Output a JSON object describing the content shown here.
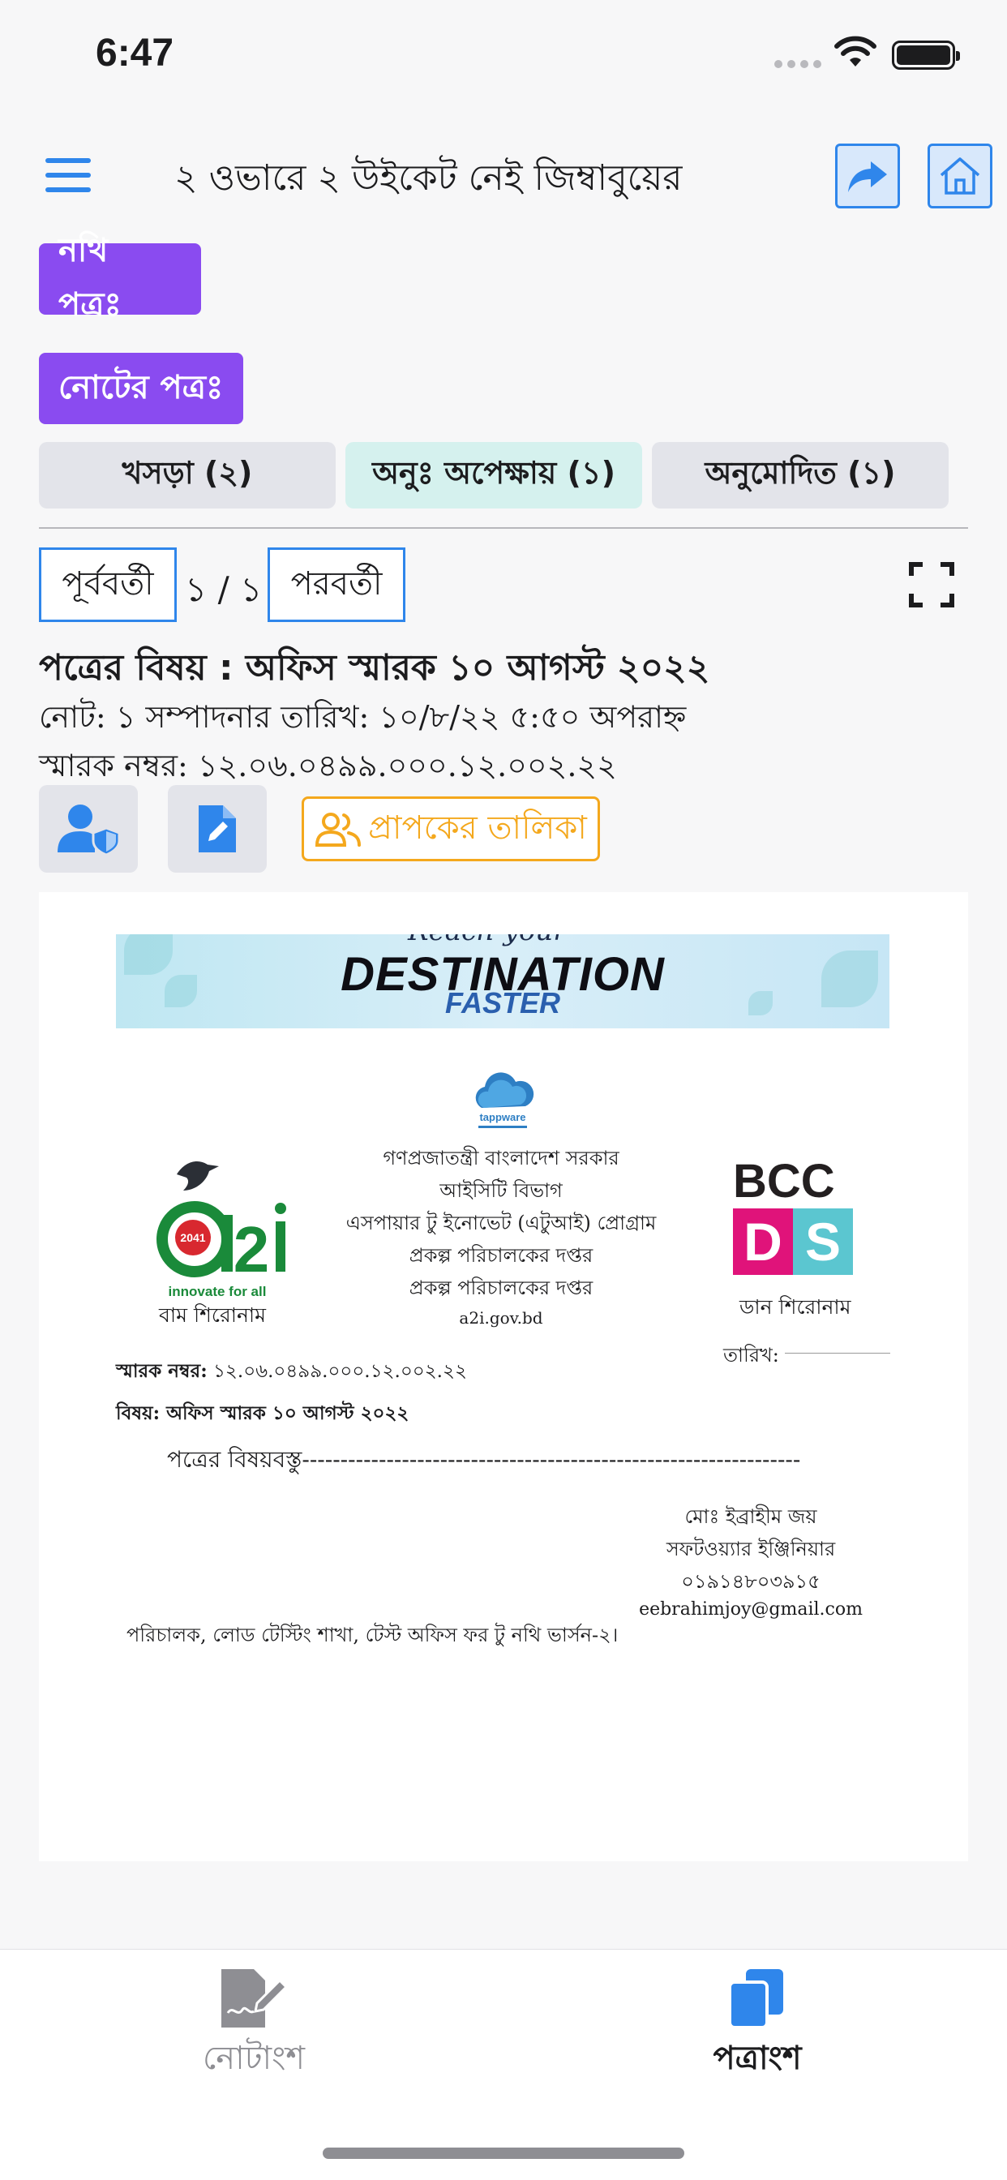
{
  "status_bar": {
    "time": "6:47"
  },
  "header": {
    "title": "২ ওভারে ২ উইকেট নেই জিম্বাবুয়ের"
  },
  "tags": {
    "nothi": "নথি পত্রঃ",
    "note": "নোটের পত্রঃ"
  },
  "tabs": [
    {
      "label": "খসড়া (২)"
    },
    {
      "label": "অনুঃ অপেক্ষায় (১)"
    },
    {
      "label": "অনুমোদিত (১)"
    }
  ],
  "pager": {
    "prev": "পূর্ববর্তী",
    "count": "১ / ১",
    "next": "পরবর্তী"
  },
  "info": {
    "subject": "পত্রের বিষয় :  অফিস স্মারক ১০ আগস্ট ২০২২",
    "note": "নোট: ১  সম্পাদনার তারিখ: ১০/৮/২২ ৫:৫০ অপরাহ্ন",
    "memo": "স্মারক নম্বর: ১২.০৬.০৪৯৯.০০০.১২.০০২.২২"
  },
  "actions": {
    "recipients": "প্রাপকের তালিকা"
  },
  "document": {
    "banner": {
      "top": "Reach your",
      "main": "DESTINATION",
      "sub": "FASTER"
    },
    "tappware": "tappware",
    "center_lines": [
      "গণপ্রজাতন্ত্রী বাংলাদেশ সরকার",
      "আইসিটি বিভাগ",
      "এসপায়ার টু ইনোভেট (এটুআই) প্রোগ্রাম",
      "প্রকল্প পরিচালকের দপ্তর",
      "প্রকল্প পরিচালকের দপ্তর"
    ],
    "url": "a2i.gov.bd",
    "a2i": {
      "year": "2041",
      "tagline": "innovate for all"
    },
    "bcc": {
      "top": "BCC",
      "d": "D",
      "s": "S"
    },
    "left_caption": "বাম শিরোনাম",
    "right_caption": "ডান শিরোনাম",
    "date_label": "তারিখ:",
    "memo_label": "স্মারক নম্বর:",
    "memo_value": "১২.০৬.০৪৯৯.০০০.১২.০০২.২২",
    "subject_label": "বিষয়:",
    "subject_value": " অফিস স্মারক ১০ আগস্ট ২০২২",
    "body": "পত্রের বিষয়বস্তু-----------------------------------------------------------------",
    "signatory": {
      "name": "মোঃ ইব্রাহীম জয়",
      "designation": "সফটওয়্যার ইঞ্জিনিয়ার",
      "phone": "০১৯১৪৮০৩৯১৫",
      "email": "eebrahimjoy@gmail.com"
    },
    "recipient": "পরিচালক, লোড টেস্টিং শাখা, টেস্ট অফিস ফর টু নথি ভার্সন-২।"
  },
  "bottom_nav": {
    "note": "নোটাংশ",
    "patra": "পত্রাংশ"
  },
  "colors": {
    "accent_blue": "#2f86eb",
    "purple": "#8a4bf0",
    "orange": "#f4a81d",
    "active_tab": "#d5f1ee"
  }
}
